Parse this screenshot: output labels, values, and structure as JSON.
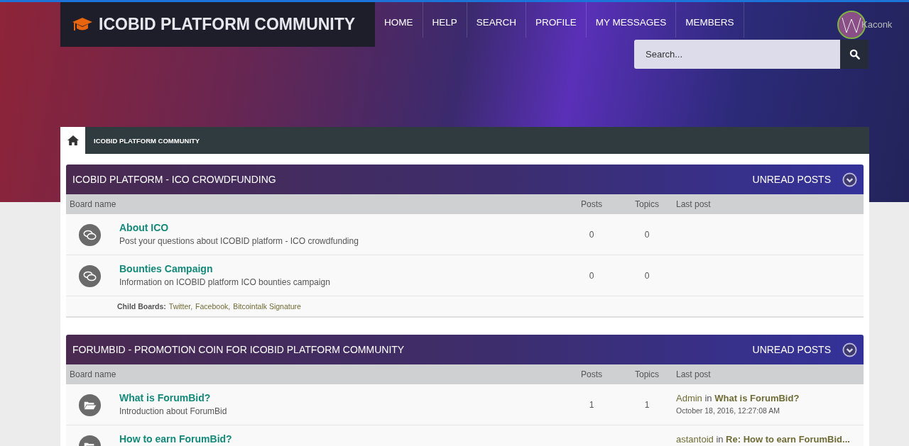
{
  "site_title": "ICOBID PLATFORM COMMUNITY",
  "nav": [
    {
      "label": "HOME"
    },
    {
      "label": "HELP"
    },
    {
      "label": "SEARCH"
    },
    {
      "label": "PROFILE"
    },
    {
      "label": "MY MESSAGES"
    },
    {
      "label": "MEMBERS"
    }
  ],
  "user": {
    "name": "Kaconk"
  },
  "search": {
    "placeholder": "Search..."
  },
  "breadcrumb": {
    "label": "ICOBID PLATFORM COMMUNITY"
  },
  "categories": [
    {
      "title": "ICOBID PLATFORM - ICO CROWDFUNDING",
      "action": "UNREAD POSTS",
      "columns": [
        "Board name",
        "Posts",
        "Topics",
        "Last post"
      ],
      "boards": [
        {
          "kind": "discussion",
          "name": "About ICO",
          "description": "Post your questions about ICOBID platform - ICO crowdfunding",
          "posts": "0",
          "topics": "0"
        },
        {
          "kind": "discussion",
          "name": "Bounties Campaign",
          "description": "Information on ICOBID platform ICO bounties campaign",
          "posts": "0",
          "topics": "0",
          "child_boards": {
            "label": "Child Boards:",
            "links": [
              "Twitter,",
              "Facebook,",
              "Bitcointalk Signature"
            ]
          }
        }
      ]
    },
    {
      "title": "FORUMBID - PROMOTION COIN FOR ICOBID PLATFORM COMMUNITY",
      "action": "UNREAD POSTS",
      "columns": [
        "Board name",
        "Posts",
        "Topics",
        "Last post"
      ],
      "boards": [
        {
          "kind": "folder",
          "name": "What is ForumBid?",
          "description": "Introduction about ForumBid",
          "posts": "1",
          "topics": "1",
          "last_post": {
            "author": "Admin",
            "word": "in",
            "topic": "What is ForumBid?",
            "date": "October 18, 2016, 12:27:08 AM"
          }
        },
        {
          "kind": "folder",
          "name": "How to earn ForumBid?",
          "last_post": {
            "author": "astantoid",
            "word": "in",
            "topic": "Re: How to earn ForumBid..."
          }
        }
      ]
    }
  ]
}
